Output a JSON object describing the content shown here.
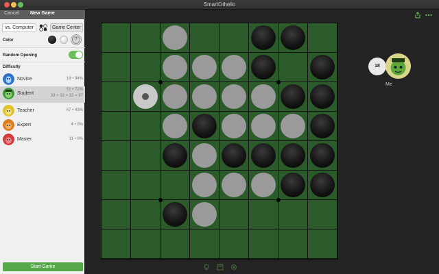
{
  "window": {
    "title": "SmartOthello"
  },
  "sidebar": {
    "cancel_label": "Cancel",
    "title": "New Game",
    "mode": {
      "computer_label": "vs. Computer",
      "gamecenter_label": "Game Center",
      "selected": "vs. Computer"
    },
    "color": {
      "label": "Color",
      "options": [
        "black",
        "white",
        "random"
      ],
      "random_glyph": "?",
      "selected": "random"
    },
    "random_opening": {
      "label": "Random Opening",
      "on": true
    },
    "difficulty": {
      "label": "Difficulty",
      "levels": [
        {
          "name": "Novice",
          "stats": "18 • 94%",
          "icon": "novice-avatar-icon",
          "color": "#2f73c9"
        },
        {
          "name": "Student",
          "stats": "51 • 72%",
          "extra": "33 + 32 + 32 = 97",
          "icon": "student-avatar-icon",
          "color": "#3b9a3a",
          "selected": true
        },
        {
          "name": "Teacher",
          "stats": "67 • 43%",
          "icon": "teacher-avatar-icon",
          "color": "#e0c22a"
        },
        {
          "name": "Expert",
          "stats": "4 • 0%",
          "icon": "expert-avatar-icon",
          "color": "#e07a1f"
        },
        {
          "name": "Master",
          "stats": "11 • 0%",
          "icon": "master-avatar-icon",
          "color": "#d23a3a"
        }
      ]
    },
    "start_label": "Start Game"
  },
  "board": {
    "size": 8,
    "rows": [
      "..W..BB.",
      "..WWWB.B",
      ".HWWWWBB",
      "..WBWWWB",
      "..BWBBBB",
      "...WWWBB",
      "..BW....",
      "........"
    ],
    "legend": {
      "B": "black",
      "W": "white",
      "H": "hint"
    }
  },
  "player": {
    "score": "18",
    "label": "Me",
    "avatar": "student-avatar-icon"
  },
  "colors": {
    "board_green": "#2b5b2b",
    "accent_green": "#57a84b",
    "toggle_green": "#6bbf57"
  },
  "icons": {
    "share": "share-icon",
    "more": "more-icon",
    "bottom": [
      "hint-icon",
      "save-icon",
      "settings-icon"
    ]
  }
}
